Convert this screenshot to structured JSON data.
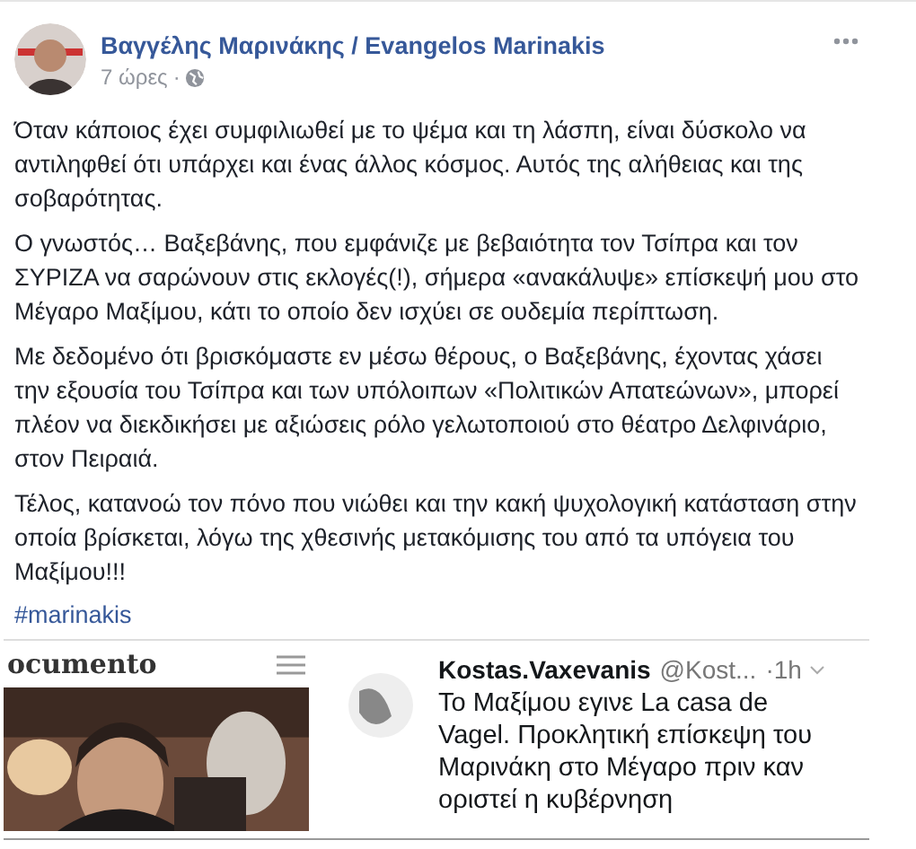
{
  "post": {
    "author": "Βαγγέλης Μαρινάκης / Evangelos Marinakis",
    "time": "7 ώρες",
    "separator": "·",
    "paragraphs": [
      "Όταν κάποιος έχει συμφιλιωθεί με το ψέμα και τη λάσπη, είναι δύσκολο να αντιληφθεί ότι υπάρχει και ένας άλλος κόσμος. Αυτός της αλήθειας και της σοβαρότητας.",
      "Ο γνωστός… Βαξεβάνης, που εμφάνιζε με βεβαιότητα τον Τσίπρα και τον ΣΥΡΙΖΑ να σαρώνουν στις εκλογές(!), σήμερα «ανακάλυψε» επίσκεψή μου στο Μέγαρο Μαξίμου, κάτι το οποίο δεν ισχύει σε ουδεμία περίπτωση.",
      "Με δεδομένο ότι βρισκόμαστε εν μέσω θέρους, ο Βαξεβάνης, έχοντας χάσει την εξουσία του Τσίπρα και των υπόλοιπων «Πολιτικών Απατεώνων», μπορεί πλέον να διεκδικήσει με αξιώσεις ρόλο γελωτοποιού στο θέατρο Δελφινάριο, στον Πειραιά.",
      "Τέλος, κατανοώ τον πόνο που νιώθει και την κακή ψυχολογική κατάσταση στην οποία βρίσκεται, λόγω της χθεσινής μετακόμισης του από τα υπόγεια του Μαξίμου!!!"
    ],
    "hashtag": "#marinakis"
  },
  "attachment": {
    "site_logo": "ocumento",
    "tweet": {
      "name": "Kostas.Vaxevanis",
      "handle": "@Kost...",
      "time": "·1h",
      "text": "Το Μαξίμου εγινε La casa de Vagel. Προκλητική επίσκεψη του Μαρινάκη στο Μέγαρο πριν καν οριστεί η κυβέρνηση"
    }
  }
}
